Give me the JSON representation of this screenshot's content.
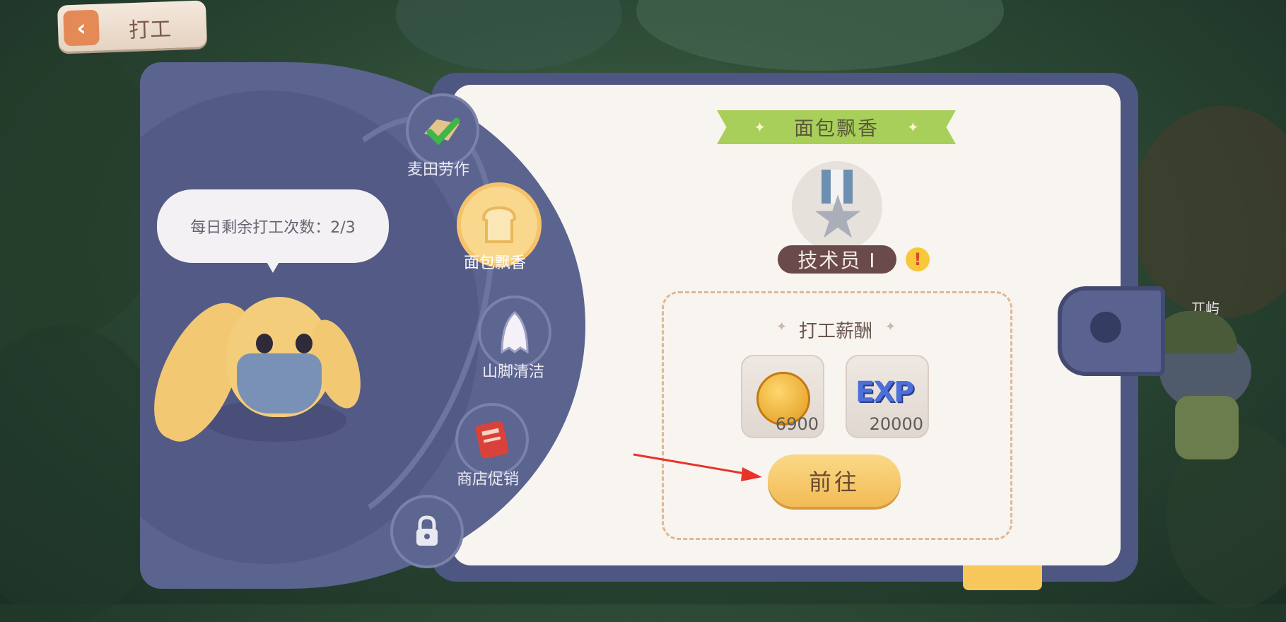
{
  "header": {
    "back_label": "打工"
  },
  "npc": {
    "remaining_text": "每日剩余打工次数：2/3"
  },
  "jobs": [
    {
      "label": "麦田劳作",
      "icon": "wheat-check-icon",
      "state": "done"
    },
    {
      "label": "面包飘香",
      "icon": "bread-icon",
      "state": "selected"
    },
    {
      "label": "山脚清洁",
      "icon": "ghost-cloth-icon",
      "state": "normal"
    },
    {
      "label": "商店促销",
      "icon": "flyer-icon",
      "state": "normal"
    },
    {
      "label": "",
      "icon": "lock-icon",
      "state": "locked"
    }
  ],
  "detail": {
    "title": "面包飘香",
    "rank": "技术员 I",
    "reward_title": "打工薪酬",
    "rewards": [
      {
        "type": "coin",
        "amount": "6900"
      },
      {
        "type": "exp",
        "icon_text": "EXP",
        "amount": "20000"
      }
    ],
    "go_label": "前往"
  },
  "side_character": {
    "name": "兀屿"
  },
  "colors": {
    "panel": "#5b638f",
    "card": "#f8f4f0",
    "ribbon": "#a8cf5a",
    "button": "#f2bb55",
    "annotation_arrow": "#e8322a"
  }
}
